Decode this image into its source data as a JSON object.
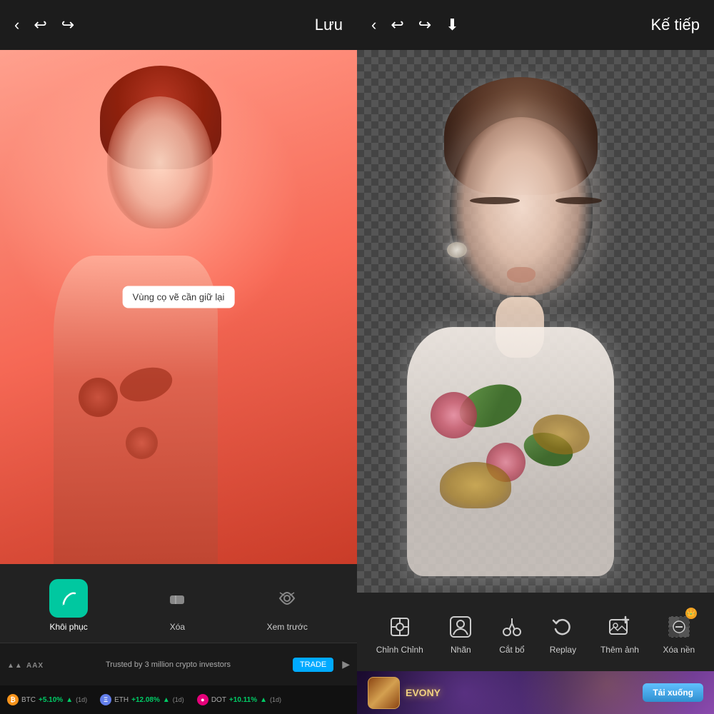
{
  "left": {
    "toolbar": {
      "save_label": "Lưu"
    },
    "tooltip": "Vùng cọ vẽ cần giữ lại",
    "tools": [
      {
        "id": "restore",
        "label": "Khôi phục",
        "active": true,
        "icon": "brush"
      },
      {
        "id": "erase",
        "label": "Xóa",
        "active": false,
        "icon": "eraser"
      },
      {
        "id": "preview",
        "label": "Xem trước",
        "active": false,
        "icon": "eye"
      }
    ]
  },
  "right": {
    "toolbar": {
      "next_label": "Kế tiếp"
    },
    "tools": [
      {
        "id": "adjust",
        "label": "Chỉnh",
        "icon": "crop"
      },
      {
        "id": "sticker",
        "label": "Nhãn",
        "icon": "sticker"
      },
      {
        "id": "cutout",
        "label": "Cắt bổ",
        "icon": "scissors"
      },
      {
        "id": "replay",
        "label": "Replay",
        "icon": "replay"
      },
      {
        "id": "addphoto",
        "label": "Thêm ảnh",
        "icon": "addphoto"
      },
      {
        "id": "removebg",
        "label": "Xóa nền",
        "icon": "removebg"
      }
    ],
    "ad": {
      "game_title": "EVONY",
      "download_label": "Tải xuống"
    }
  },
  "ad_bar": {
    "logo": "AAX",
    "tagline": "Trusted by 3 million crypto investors",
    "trade_label": "TRADE",
    "coins": [
      {
        "symbol": "BTC",
        "name": "BTC",
        "change": "+5.10%",
        "period": "(1d)"
      },
      {
        "symbol": "ETH",
        "name": "ETH",
        "change": "+12.08%",
        "period": "(1d)"
      },
      {
        "symbol": "DOT",
        "name": "DOT",
        "change": "+10.11%",
        "period": "(1d)"
      }
    ]
  },
  "colors": {
    "accent_green": "#00c8a0",
    "toolbar_bg": "#1c1c1c",
    "panel_bg": "#222222",
    "text_white": "#ffffff",
    "text_gray": "#cccccc"
  }
}
